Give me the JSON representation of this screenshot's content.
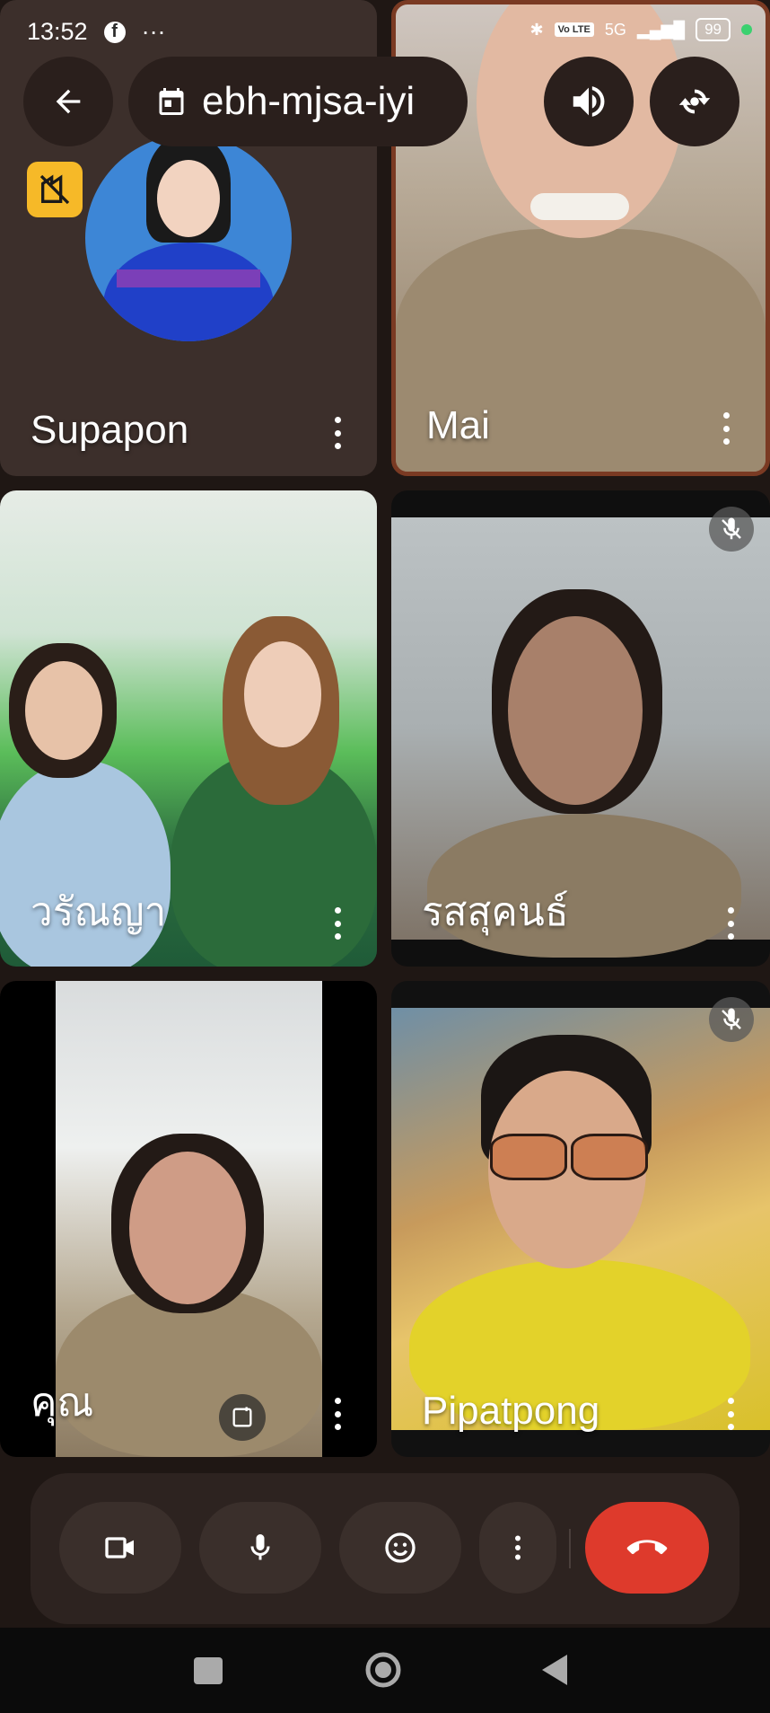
{
  "status_bar": {
    "time": "13:52",
    "more": "···",
    "volte": "Vo LTE",
    "network": "5G",
    "battery": "99"
  },
  "meeting": {
    "code": "ebh-mjsa-iyi"
  },
  "tiles": [
    {
      "name": "Supapon"
    },
    {
      "name": "Mai"
    },
    {
      "name": "วรัณญา"
    },
    {
      "name": "รสสุคนธ์",
      "muted": true
    },
    {
      "name": "คุณ"
    },
    {
      "name": "Pipatpong",
      "muted": true
    }
  ],
  "icons": {
    "back": "arrow-left-icon",
    "calendar": "calendar-icon",
    "speaker": "speaker-icon",
    "flip": "switch-camera-icon",
    "camera": "video-camera-icon",
    "mic": "microphone-icon",
    "emoji": "emoji-icon",
    "more": "more-vert-icon",
    "hangup": "end-call-icon"
  },
  "colors": {
    "end_call": "#de3a2c",
    "background": "#1f1714",
    "low_bandwidth": "#f6b928",
    "active_speaker_border": "#7a3a23"
  }
}
